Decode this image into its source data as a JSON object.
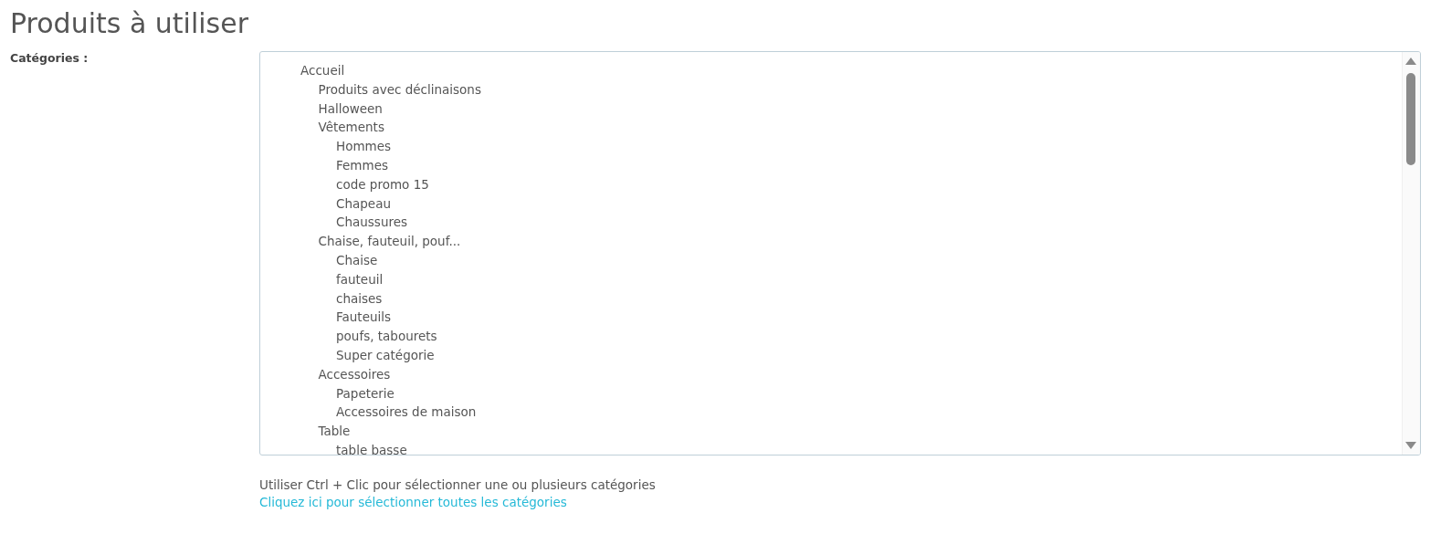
{
  "heading": "Produits à utiliser",
  "field_label": "Catégories :",
  "categories": [
    {
      "label": "Accueil",
      "selected": false,
      "children": [
        {
          "label": "Produits avec déclinaisons",
          "selected": false
        },
        {
          "label": "Halloween",
          "selected": false
        },
        {
          "label": "Vêtements",
          "selected": false,
          "children": [
            {
              "label": "Hommes",
              "selected": false
            },
            {
              "label": "Femmes",
              "selected": false
            },
            {
              "label": "code promo 15",
              "selected": false
            },
            {
              "label": "Chapeau",
              "selected": false
            },
            {
              "label": "Chaussures",
              "selected": false
            }
          ]
        },
        {
          "label": "Chaise, fauteuil, pouf...",
          "selected": false,
          "children": [
            {
              "label": "Chaise",
              "selected": false
            },
            {
              "label": "fauteuil",
              "selected": false
            },
            {
              "label": "chaises",
              "selected": false
            },
            {
              "label": "Fauteuils",
              "selected": false
            },
            {
              "label": "poufs, tabourets",
              "selected": false
            },
            {
              "label": "Super catégorie",
              "selected": false
            }
          ]
        },
        {
          "label": "Accessoires",
          "selected": false,
          "children": [
            {
              "label": "Papeterie",
              "selected": false
            },
            {
              "label": "Accessoires de maison",
              "selected": false
            }
          ]
        },
        {
          "label": "Table",
          "selected": false,
          "children": [
            {
              "label": "table basse",
              "selected": false
            }
          ]
        }
      ]
    }
  ],
  "help_text": "Utiliser Ctrl + Clic pour sélectionner une ou plusieurs catégories",
  "select_all_link": "Cliquez ici pour sélectionner toutes les catégories"
}
